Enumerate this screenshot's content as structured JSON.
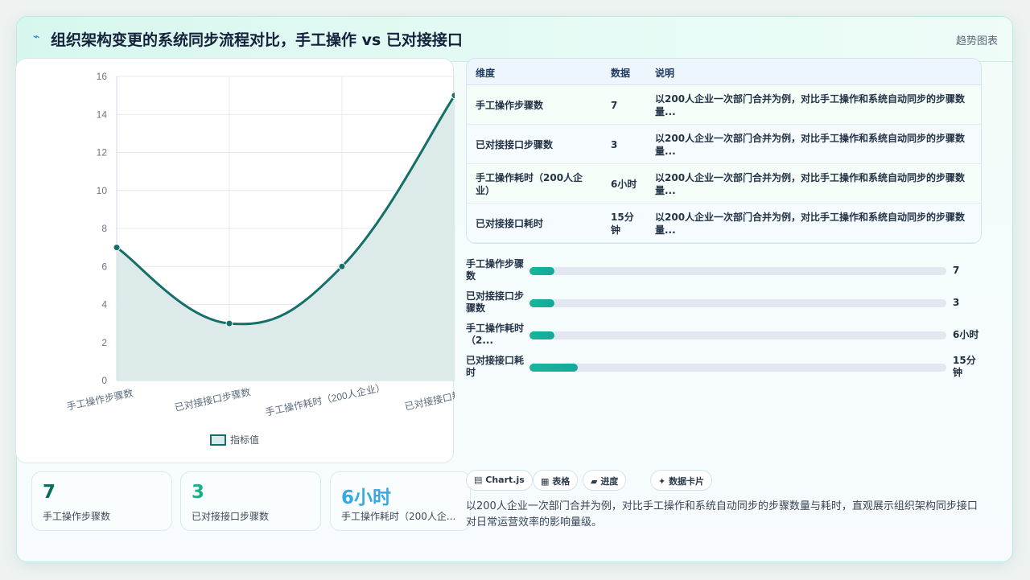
{
  "header": {
    "logo_icon": "pulse-icon",
    "title": "组织架构变更的系统同步流程对比，手工操作 vs 已对接接口",
    "tag": "趋势图表"
  },
  "chart_data": {
    "type": "line",
    "categories": [
      "手工操作步骤数",
      "已对接接口步骤数",
      "手工操作耗时（200人企业）",
      "已对接接口耗时"
    ],
    "series": [
      {
        "name": "指标值",
        "values": [
          7,
          3,
          6,
          15
        ]
      }
    ],
    "ylim": [
      0,
      16
    ],
    "yticks": [
      0,
      2,
      4,
      6,
      8,
      10,
      12,
      14,
      16
    ],
    "line_color": "#147068",
    "fill_color": "#dbe9e9",
    "grid": true,
    "legend_position": "bottom"
  },
  "stats": [
    {
      "value": "7",
      "label": "手工操作步骤数",
      "color": "#0f6b5c"
    },
    {
      "value": "3",
      "label": "已对接接口步骤数",
      "color": "#1aae8a"
    },
    {
      "value": "6小时",
      "label": "手工操作耗时（200人企...",
      "color": "#35a9e0"
    }
  ],
  "table": {
    "headers": [
      "维度",
      "数据",
      "说明"
    ],
    "rows": [
      {
        "dim": "手工操作步骤数",
        "val": "7",
        "desc": "以200人企业一次部门合并为例，对比手工操作和系统自动同步的步骤数量..."
      },
      {
        "dim": "已对接接口步骤数",
        "val": "3",
        "desc": "以200人企业一次部门合并为例，对比手工操作和系统自动同步的步骤数量..."
      },
      {
        "dim": "手工操作耗时（200人企业）",
        "val": "6小时",
        "desc": "以200人企业一次部门合并为例，对比手工操作和系统自动同步的步骤数量..."
      },
      {
        "dim": "已对接接口耗时",
        "val": "15分钟",
        "desc": "以200人企业一次部门合并为例，对比手工操作和系统自动同步的步骤数量..."
      }
    ]
  },
  "progress": [
    {
      "label": "手工操作步骤数",
      "value": "7",
      "fraction": 0.06
    },
    {
      "label": "已对接接口步骤数",
      "value": "3",
      "fraction": 0.06
    },
    {
      "label": "手工操作耗时（2...",
      "value": "6小时",
      "fraction": 0.06
    },
    {
      "label": "已对接接口耗时",
      "value": "15分钟",
      "fraction": 0.115
    }
  ],
  "chips": [
    {
      "icon": "chart-icon",
      "glyph": "▤",
      "label": "Chart.js"
    },
    {
      "icon": "table-icon",
      "glyph": "▦",
      "label": "表格"
    },
    {
      "icon": "progress-icon",
      "glyph": "▰",
      "label": "进度"
    },
    {
      "icon": "sparkle-icon",
      "glyph": "✦",
      "label": "数据卡片"
    }
  ],
  "description": "以200人企业一次部门合并为例，对比手工操作和系统自动同步的步骤数量与耗时，直观展示组织架构同步接口对日常运营效率的影响量级。"
}
